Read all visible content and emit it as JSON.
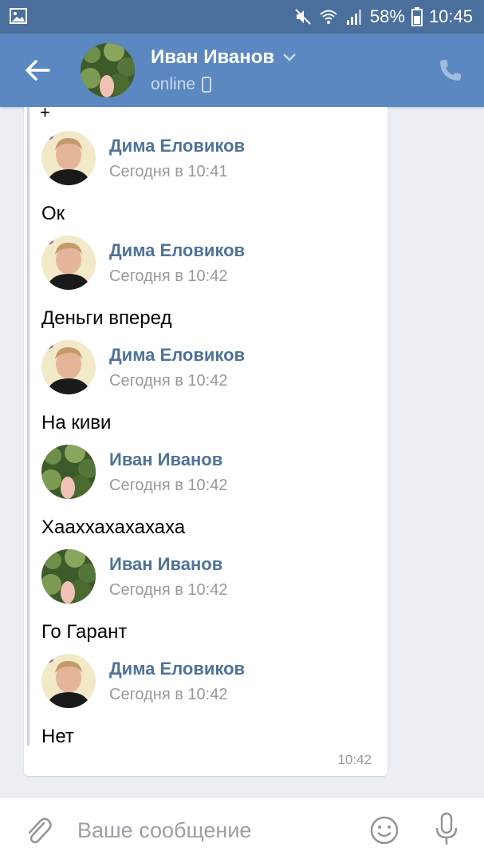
{
  "status_bar": {
    "battery_percent": "58%",
    "time": "10:45",
    "icons": [
      "gallery-icon",
      "mute-icon",
      "wifi-icon",
      "signal-icon",
      "battery-icon"
    ]
  },
  "header": {
    "contact_name": "Иван Иванов",
    "presence": "online",
    "icons": [
      "back-arrow-icon",
      "chevron-down-icon",
      "mobile-icon",
      "phone-icon"
    ]
  },
  "forwarded": {
    "messages": [
      {
        "author": "Дима Еловиков",
        "time": "Сегодня в 10:41",
        "text": "Ок",
        "avatar": "dima"
      },
      {
        "author": "Дима Еловиков",
        "time": "Сегодня в 10:42",
        "text": "Деньги вперед",
        "avatar": "dima"
      },
      {
        "author": "Дима Еловиков",
        "time": "Сегодня в 10:42",
        "text": "На киви",
        "avatar": "dima"
      },
      {
        "author": "Иван Иванов",
        "time": "Сегодня в 10:42",
        "text": "Хааххахахахаха",
        "avatar": "ivan"
      },
      {
        "author": "Иван Иванов",
        "time": "Сегодня в 10:42",
        "text": "Го Гарант",
        "avatar": "ivan"
      },
      {
        "author": "Дима Еловиков",
        "time": "Сегодня в 10:42",
        "text": "Нет",
        "avatar": "dima"
      }
    ],
    "timestamp": "10:42"
  },
  "composer": {
    "placeholder": "Ваше сообщение",
    "icons": [
      "attach-icon",
      "emoji-icon",
      "microphone-icon"
    ]
  },
  "colors": {
    "status_bar": "#4a6f9c",
    "header": "#5b88c1",
    "author_name": "#4e7399",
    "background": "#ebeef2"
  }
}
